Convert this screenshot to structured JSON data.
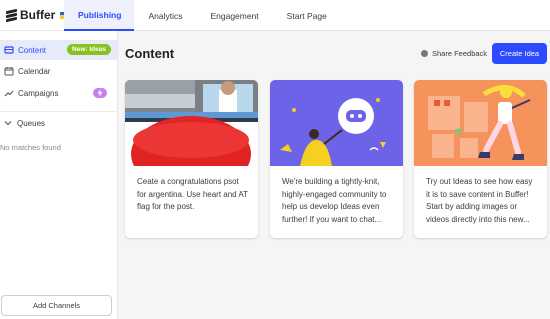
{
  "app": {
    "brand": "Buffer"
  },
  "tabs": [
    {
      "label": "Publishing",
      "active": true
    },
    {
      "label": "Analytics"
    },
    {
      "label": "Engagement"
    },
    {
      "label": "Start Page"
    }
  ],
  "sidebar": {
    "items": [
      {
        "label": "Content",
        "badge": "New: Ideas",
        "active": true
      },
      {
        "label": "Calendar"
      },
      {
        "label": "Campaigns"
      }
    ],
    "queues_label": "Queues",
    "no_matches": "No matches found",
    "add_channels": "Add Channels"
  },
  "main": {
    "title": "Content",
    "share_feedback": "Share Feedback",
    "create_button": "Create Idea",
    "cards": [
      {
        "text": "Ceate a congratulations psot for argentina. Use heart and AT flag for the post."
      },
      {
        "text": "We're building a tightly-knit, highly-engaged community to help us develop Ideas even further! If you want to chat..."
      },
      {
        "text": "Try out Ideas to see how easy it is to save content in Buffer! Start by adding images or videos directly into this new..."
      }
    ]
  },
  "colors": {
    "accent": "#2c4bff",
    "badge_green": "#87c221",
    "badge_purple": "#c67eef"
  }
}
